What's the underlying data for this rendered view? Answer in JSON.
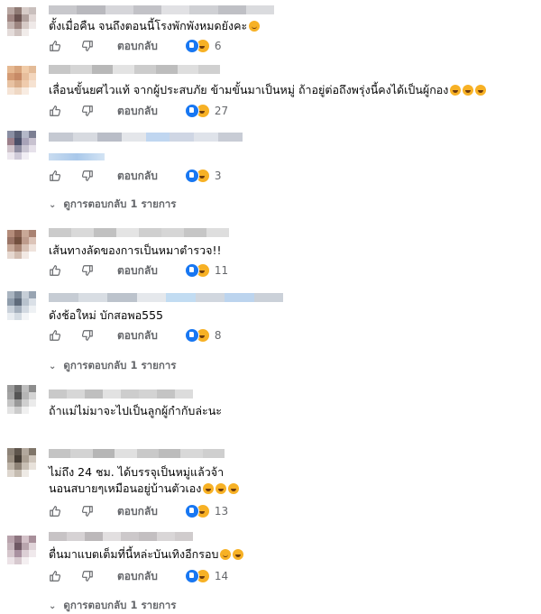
{
  "labels": {
    "reply": "ตอบกลับ"
  },
  "comments": [
    {
      "text": "ตั้งเมื่อคืน จนถึงตอนนี้โรงพักพังหมดยังคะ",
      "emojis": [
        "smile"
      ],
      "reaction_count": "6",
      "avatar_colors": [
        "#b9a7a2",
        "#8f7a74",
        "#d7ccc8",
        "#c9bfbd",
        "#a08682",
        "#6b5350",
        "#b0a09c",
        "#e2d8d6",
        "#c2b2ae",
        "#9c8580",
        "#d6cac6",
        "#efe9e8",
        "#e4dcda",
        "#cfc3c0",
        "#f1ecea",
        "#ffffff"
      ]
    },
    {
      "text": "เลื่อนขั้นยศไวแท้ จากผู้ประสบภัย ข้ามขั้นมาเป็นหมู่ ถ้าอยู่ต่อถึงพรุ่งนี้คงได้เป็นผู้กอง",
      "emojis": [
        "laugh",
        "laugh",
        "laugh"
      ],
      "reaction_count": "27",
      "avatar_colors": [
        "#e6b992",
        "#d8a57d",
        "#f0cba8",
        "#e3bb98",
        "#d49b74",
        "#c78a66",
        "#e7be9c",
        "#f3d6bd",
        "#e8c2a2",
        "#d9ad8b",
        "#efcbad",
        "#f6e2d1",
        "#f5e4d6",
        "#efd8c4",
        "#f8ece2",
        "#ffffff"
      ]
    },
    {
      "text": "",
      "emojis": [],
      "reaction_count": "3",
      "replies_label": "ดูการตอบกลับ 1 รายการ",
      "avatar_colors": [
        "#8a8fa3",
        "#5d6277",
        "#b4b8c8",
        "#7c7f93",
        "#9b7f8a",
        "#4a4f68",
        "#a8a3b8",
        "#c8c2d0",
        "#d0c4cc",
        "#8f8da1",
        "#c9c5d2",
        "#e6e1ea",
        "#ece7ee",
        "#cfcad8",
        "#f1eef4",
        "#ffffff"
      ]
    },
    {
      "text": "เส้นทางลัดของการเป็นหมาตำรวจ!!",
      "emojis": [],
      "reaction_count": "11",
      "avatar_colors": [
        "#b48c7a",
        "#8c6353",
        "#c9a897",
        "#a98272",
        "#9a7466",
        "#73503f",
        "#bd9b8c",
        "#dcc4b8",
        "#c7a999",
        "#a88575",
        "#d7c0b4",
        "#efe3dc",
        "#e6d8d0",
        "#d2bdb1",
        "#f2e9e4",
        "#ffffff"
      ]
    },
    {
      "text": "ดังช้อใหม่ บักสอพอ555",
      "emojis": [],
      "reaction_count": "8",
      "replies_label": "ดูการตอบกลับ 1 รายการ",
      "avatar_colors": [
        "#a9b4c0",
        "#7d8a99",
        "#c6ced7",
        "#98a4b2",
        "#8f9cab",
        "#5f6b7b",
        "#b8c2cd",
        "#dae0e7",
        "#c9d1da",
        "#a4afbc",
        "#d3dae2",
        "#eef1f4",
        "#e9edf1",
        "#d5dce3",
        "#f3f5f7",
        "#ffffff"
      ]
    },
    {
      "text": "ถ้าแม่ไม่มาจะไปเป็นลูกผู้กำกับล่ะนะ",
      "emojis": [],
      "reaction_count": "",
      "avatar_colors": [
        "#9c9c9c",
        "#6e6e6e",
        "#bdbdbd",
        "#8d8d8d",
        "#a3a3a3",
        "#555555",
        "#b5b5b5",
        "#d4d4d4",
        "#c4c4c4",
        "#999999",
        "#cfcfcf",
        "#ebebeb",
        "#e3e3e3",
        "#cccccc",
        "#f0f0f0",
        "#ffffff"
      ]
    },
    {
      "text": "ไม่ถึง 24 ชม. ได้บรรจุเป็นหมู่แล้วจ้า",
      "text2": "นอนสบายๆเหมือนอยู่บ้านตัวเอง",
      "emojis": [
        "laugh",
        "laugh",
        "laugh"
      ],
      "reaction_count": "13",
      "avatar_colors": [
        "#8d8378",
        "#5e554c",
        "#b2a89d",
        "#7f7569",
        "#9a8f82",
        "#463e36",
        "#a99e91",
        "#cfc6bc",
        "#bdb3a7",
        "#8e8377",
        "#c8bfb4",
        "#e8e2db",
        "#ded7cf",
        "#c5bcb1",
        "#eeeae5",
        "#ffffff"
      ]
    },
    {
      "text": "ตื่นมาแบตเต็มที่นี้หล่ะบันเทิงอีกรอบ",
      "emojis": [
        "smile",
        "laugh"
      ],
      "reaction_count": "14",
      "replies_label": "ดูการตอบกลับ 1 รายการ",
      "avatar_colors": [
        "#b9a3ac",
        "#8d7580",
        "#d3c1c8",
        "#a88f9a",
        "#c4b3ba",
        "#6f5964",
        "#b8a5ad",
        "#e0d4d9",
        "#d5c6cc",
        "#a991a0",
        "#dccfd5",
        "#f0e9ec",
        "#ece3e7",
        "#d7c9cf",
        "#f4eff1",
        "#ffffff"
      ]
    }
  ]
}
